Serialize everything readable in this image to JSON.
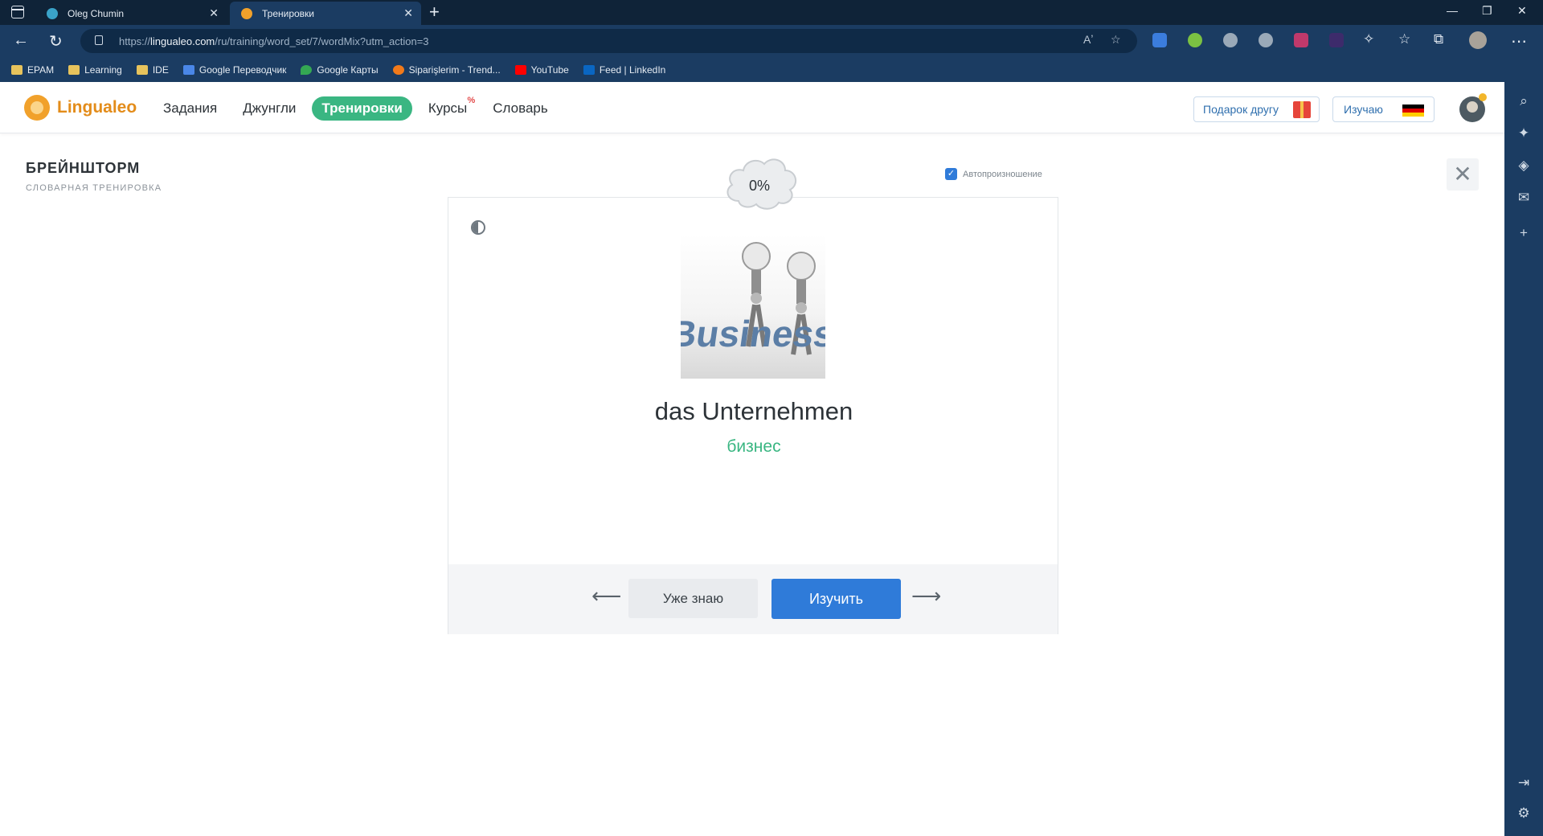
{
  "browser": {
    "tabs": [
      {
        "title": "Oleg Chumin",
        "close": "✕"
      },
      {
        "title": "Тренировки",
        "close": "✕"
      }
    ],
    "new_tab": "+",
    "window_controls": {
      "minimize": "—",
      "restore": "❐",
      "close": "✕"
    },
    "url_prefix": "https://",
    "url_host": "lingualeo.com",
    "url_path": "/ru/training/word_set/7/wordMix?utm_action=3",
    "bookmarks": [
      "EPAM",
      "Learning",
      "IDE",
      "Google Переводчик",
      "Google Карты",
      "Siparişlerim - Trend...",
      "YouTube",
      "Feed | LinkedIn"
    ]
  },
  "site": {
    "logo_text": "Lingualeo",
    "nav": {
      "tasks": "Задания",
      "jungle": "Джунгли",
      "trainings": "Тренировки",
      "courses": "Курсы",
      "courses_badge": "%",
      "dictionary": "Словарь"
    },
    "gift_button": "Подарок другу",
    "learning_button": "Изучаю",
    "flag_colors": [
      "#000000",
      "#dd0000",
      "#ffce00"
    ]
  },
  "training": {
    "title": "БРЕЙНШТОРМ",
    "subtitle": "СЛОВАРНАЯ ТРЕНИРОВКА",
    "autopronounce_label": "Автопроизношение",
    "autopronounce_checked": true,
    "progress_text": "0%",
    "word": "das Unternehmen",
    "translation": "бизнес",
    "image_text": "Business",
    "know_button": "Уже знаю",
    "learn_button": "Изучить",
    "arrow_left": "⟵",
    "arrow_right": "⟶",
    "close": "✕"
  },
  "colors": {
    "accent_green": "#3ab682",
    "primary_blue": "#2f7bd9",
    "logo_orange": "#e38c1a"
  }
}
